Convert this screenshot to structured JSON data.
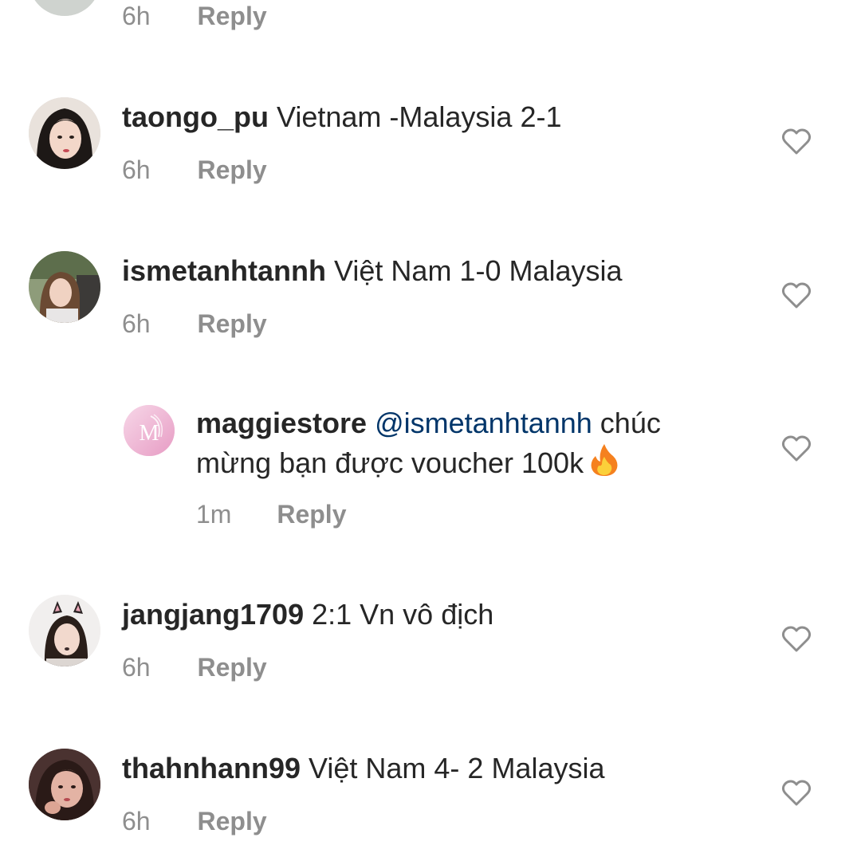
{
  "comments": [
    {
      "username": "",
      "text": "",
      "time": "6h",
      "reply_label": "Reply"
    },
    {
      "username": "taongo_pu",
      "text": " Vietnam -Malaysia 2-1",
      "time": "6h",
      "reply_label": "Reply"
    },
    {
      "username": "ismetanhtannh",
      "text": " Việt Nam 1-0 Malaysia",
      "time": "6h",
      "reply_label": "Reply"
    },
    {
      "username": "maggiestore",
      "mention": " @ismetanhtannh",
      "text_line1": " chúc",
      "text_line2": "mừng bạn được voucher 100k",
      "emoji": "fire-emoji",
      "avatar_letter": "M",
      "time": "1m",
      "reply_label": "Reply"
    },
    {
      "username": "jangjang1709",
      "text": " 2:1 Vn vô địch",
      "time": "6h",
      "reply_label": "Reply"
    },
    {
      "username": "thahnhann99",
      "text": " Việt Nam 4- 2 Malaysia",
      "time": "6h",
      "reply_label": "Reply"
    }
  ],
  "icons": {
    "like": "heart-outline-icon",
    "emoji": "fire-emoji"
  },
  "colors": {
    "background": "#ffffff",
    "text": "#262626",
    "secondary": "#8e8e8e",
    "mention": "#003569"
  }
}
